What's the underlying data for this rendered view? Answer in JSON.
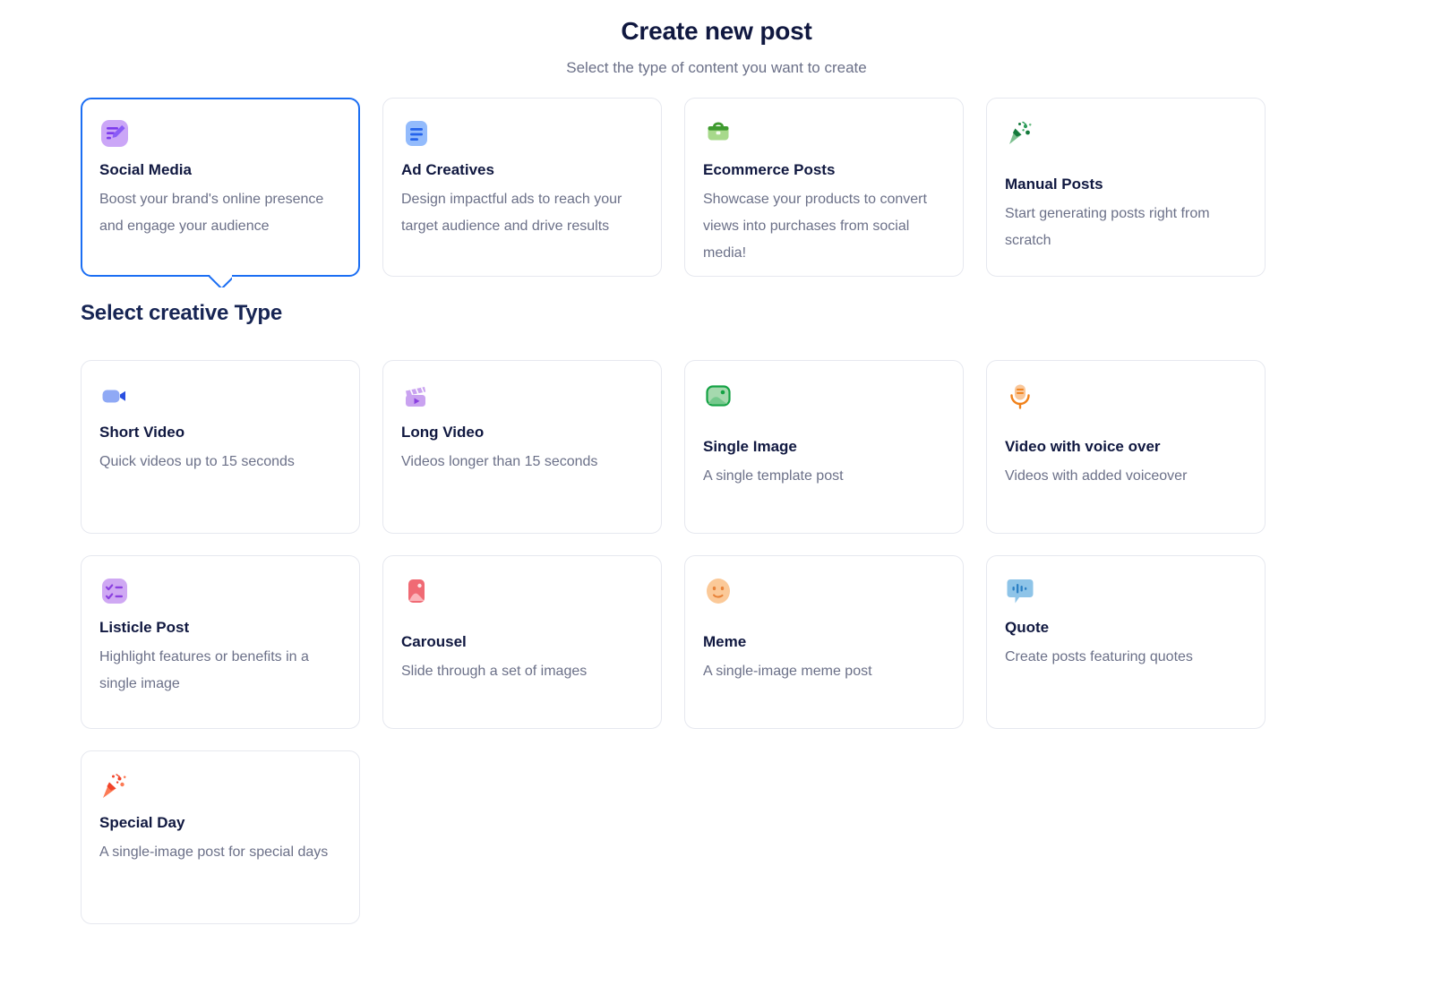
{
  "header": {
    "title": "Create new post",
    "subtitle": "Select the type of content you want to create"
  },
  "section": {
    "creative_heading": "Select creative Type"
  },
  "post_types": [
    {
      "id": "social-media",
      "icon": "note-pencil-icon",
      "title": "Social Media",
      "desc": "Boost your brand's online presence and engage your audience",
      "selected": true,
      "icon_colors": {
        "bg": "#cba6f7",
        "fg": "#8b5cf6"
      }
    },
    {
      "id": "ad-creatives",
      "icon": "document-lines-icon",
      "title": "Ad Creatives",
      "desc": "Design impactful ads to reach your target audience and drive results",
      "selected": false,
      "icon_colors": {
        "bg": "#93bbfc",
        "fg": "#2563eb"
      }
    },
    {
      "id": "ecommerce-posts",
      "icon": "briefcase-icon",
      "title": "Ecommerce Posts",
      "desc": "Showcase your products to convert views into purchases from social media!",
      "selected": false,
      "icon_colors": {
        "bg": "#a7d98b",
        "fg": "#3f9b2f"
      }
    },
    {
      "id": "manual-posts",
      "icon": "party-popper-green-icon",
      "title": "Manual Posts",
      "desc": "Start generating posts right from scratch",
      "selected": false,
      "icon_colors": {
        "bg": "#7cc08f",
        "fg": "#157a3c"
      }
    }
  ],
  "creative_types": [
    {
      "id": "short-video",
      "icon": "video-camera-icon",
      "title": "Short Video",
      "desc": "Quick videos up to 15 seconds",
      "icon_colors": {
        "bg": "#8fa9f5",
        "fg": "#2a4fe0"
      }
    },
    {
      "id": "long-video",
      "icon": "clapperboard-icon",
      "title": "Long Video",
      "desc": "Videos longer than 15 seconds",
      "icon_colors": {
        "bg": "#c9a2f0",
        "fg": "#8b3fe0"
      }
    },
    {
      "id": "single-image",
      "icon": "image-icon",
      "title": "Single Image",
      "desc": "A single template post",
      "icon_colors": {
        "bg": "#a5d9ae",
        "fg": "#14a244"
      }
    },
    {
      "id": "video-with-voice-over",
      "icon": "microphone-icon",
      "title": "Video with voice over",
      "desc": "Videos with added voiceover",
      "icon_colors": {
        "bg": "#f9c79a",
        "fg": "#f0811a"
      }
    },
    {
      "id": "listicle-post",
      "icon": "checklist-icon",
      "title": "Listicle Post",
      "desc": "Highlight features or benefits in a single image",
      "icon_colors": {
        "bg": "#cfa8f3",
        "fg": "#8b3fe0"
      }
    },
    {
      "id": "carousel",
      "icon": "image-stack-icon",
      "title": "Carousel",
      "desc": "Slide through a set of images",
      "icon_colors": {
        "bg": "#f06a74",
        "fg": "#e03a48"
      }
    },
    {
      "id": "meme",
      "icon": "smiley-face-icon",
      "title": "Meme",
      "desc": "A single-image meme post",
      "icon_colors": {
        "bg": "#fbc998",
        "fg": "#e8833a"
      }
    },
    {
      "id": "quote",
      "icon": "speech-bubble-waveform-icon",
      "title": "Quote",
      "desc": "Create posts featuring quotes",
      "icon_colors": {
        "bg": "#8ec4e8",
        "fg": "#2b7fc4"
      }
    },
    {
      "id": "special-day",
      "icon": "party-popper-orange-icon",
      "title": "Special Day",
      "desc": "A single-image post for special days",
      "icon_colors": {
        "bg": "#fc7a54",
        "fg": "#f2442a"
      }
    }
  ],
  "colors": {
    "accent": "#1b6ef3",
    "title": "#101840",
    "muted": "#6b7088",
    "border": "#e6e8ef"
  }
}
